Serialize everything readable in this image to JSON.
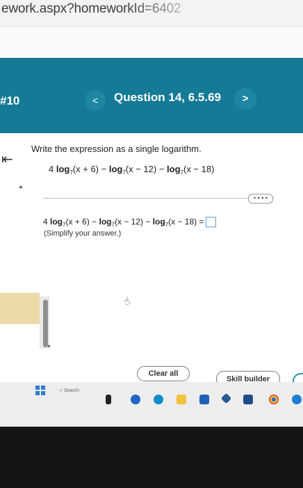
{
  "browser": {
    "url_fragment": "ework.aspx?homeworkId=6402"
  },
  "header": {
    "homework_number": "#10",
    "question_title": "Question 14, 6.5.69",
    "prev_symbol": "<",
    "next_symbol": ">"
  },
  "question": {
    "back_symbol": "⇤",
    "prompt": "Write the expression as a single logarithm.",
    "expr": {
      "coef": "4 ",
      "log": "log",
      "base": "7",
      "arg1": "(x + 6) − ",
      "arg2": "(x − 12) − ",
      "arg3": "(x − 18)"
    }
  },
  "answer": {
    "expr": {
      "coef": "4 ",
      "log": "log",
      "base": "7",
      "arg1": "(x + 6) − ",
      "arg2": "(x − 12) − ",
      "arg3": "(x − 18) ="
    },
    "hint": "(Simplify your answer.)"
  },
  "controls": {
    "more_label": "• • • •",
    "clear_all": "Clear all",
    "skill_builder": "Skill builder"
  },
  "taskbar": {
    "search_label": "Search"
  },
  "colors": {
    "header": "#147a96",
    "nav_button": "#1d86a3",
    "answer_box_border": "#5a9fd1"
  }
}
